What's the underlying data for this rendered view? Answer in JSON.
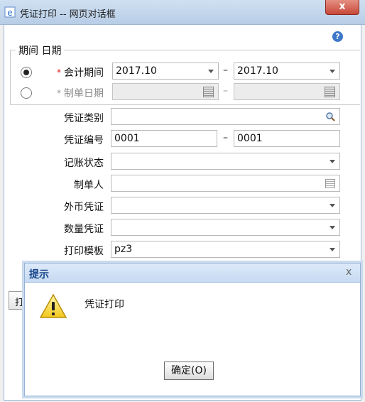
{
  "window": {
    "title": "凭证打印 -- 网页对话框",
    "close_label": "x"
  },
  "help": {
    "icon": "question-icon",
    "label": "?"
  },
  "fieldset": {
    "legend": "期间 日期"
  },
  "form": {
    "account_period": {
      "label": "会计期间",
      "required_mark": "*",
      "from": "2017.10",
      "to": "2017.10",
      "selected": true
    },
    "voucher_date": {
      "label": "制单日期",
      "required_mark": "*",
      "from": "",
      "to": "",
      "selected": false
    },
    "voucher_category": {
      "label": "凭证类别",
      "value": ""
    },
    "voucher_number": {
      "label": "凭证编号",
      "from": "0001",
      "to": "0001"
    },
    "posting_status": {
      "label": "记账状态",
      "value": ""
    },
    "preparer": {
      "label": "制单人",
      "value": ""
    },
    "foreign_currency_voucher": {
      "label": "外币凭证",
      "value": ""
    },
    "quantity_voucher": {
      "label": "数量凭证",
      "value": ""
    },
    "print_template": {
      "label": "打印模板",
      "value": "pz3"
    },
    "range_separator": "–"
  },
  "background_button": {
    "label": "打"
  },
  "alert": {
    "title": "提示",
    "close_label": "x",
    "message": "凭证打印",
    "ok_label": "确定(O)"
  }
}
